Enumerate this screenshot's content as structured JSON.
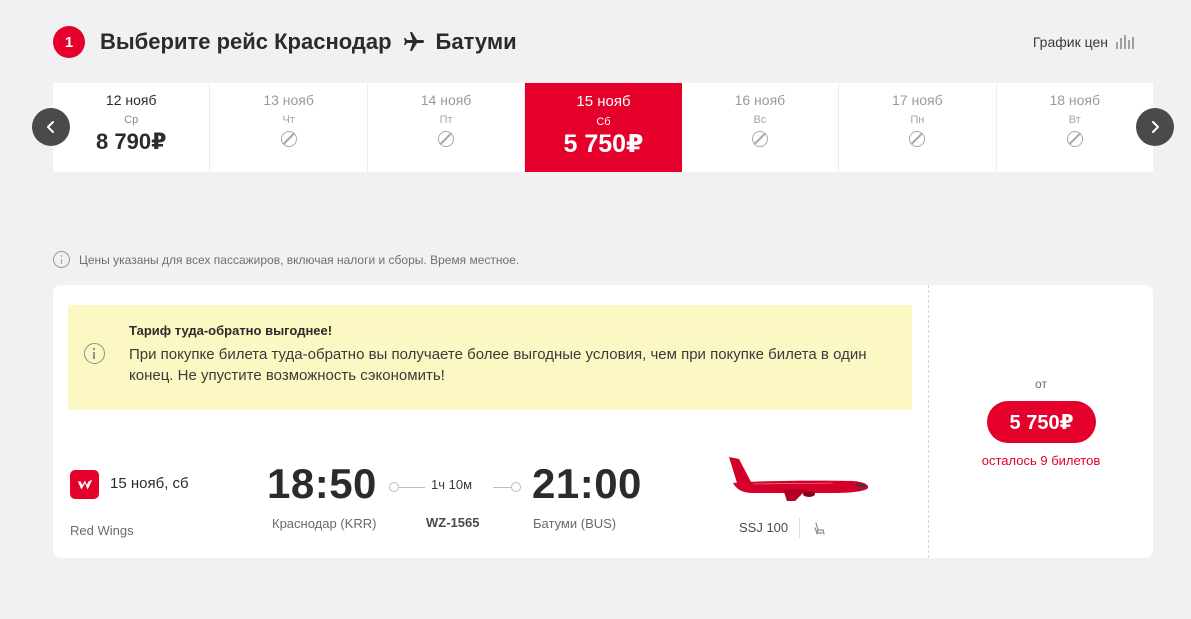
{
  "header": {
    "step": "1",
    "title_prefix": "Выберите рейс Краснодар",
    "destination": "Батуми",
    "price_chart_label": "График цен"
  },
  "dates": [
    {
      "date": "12 нояб",
      "weekday": "Ср",
      "price": "8 790₽",
      "available": true,
      "active": false
    },
    {
      "date": "13 нояб",
      "weekday": "Чт",
      "available": false,
      "active": false
    },
    {
      "date": "14 нояб",
      "weekday": "Пт",
      "available": false,
      "active": false
    },
    {
      "date": "15 нояб",
      "weekday": "Сб",
      "price": "5 750₽",
      "available": true,
      "active": true
    },
    {
      "date": "16 нояб",
      "weekday": "Вс",
      "available": false,
      "active": false
    },
    {
      "date": "17 нояб",
      "weekday": "Пн",
      "available": false,
      "active": false
    },
    {
      "date": "18 нояб",
      "weekday": "Вт",
      "available": false,
      "active": false
    }
  ],
  "notice": "Цены указаны для всех пассажиров, включая налоги и сборы. Время местное.",
  "promo": {
    "title": "Тариф туда-обратно выгоднее!",
    "text": "При покупке билета туда-обратно вы получаете более выгодные условия, чем при покупке билета в один конец. Не упустите возможность сэкономить!"
  },
  "flight": {
    "date": "15 нояб, сб",
    "airline": "Red Wings",
    "departure_time": "18:50",
    "departure_city": "Краснодар (KRR)",
    "duration": "1ч 10м",
    "flight_number": "WZ-1565",
    "arrival_time": "21:00",
    "arrival_city": "Батуми (BUS)",
    "aircraft": "SSJ 100"
  },
  "price_box": {
    "from_label": "от",
    "price": "5 750₽",
    "seats_left": "осталось 9 билетов"
  },
  "colors": {
    "accent": "#e4002b",
    "promo_bg": "#fcf8c4",
    "page_bg": "#f1f1f3"
  }
}
